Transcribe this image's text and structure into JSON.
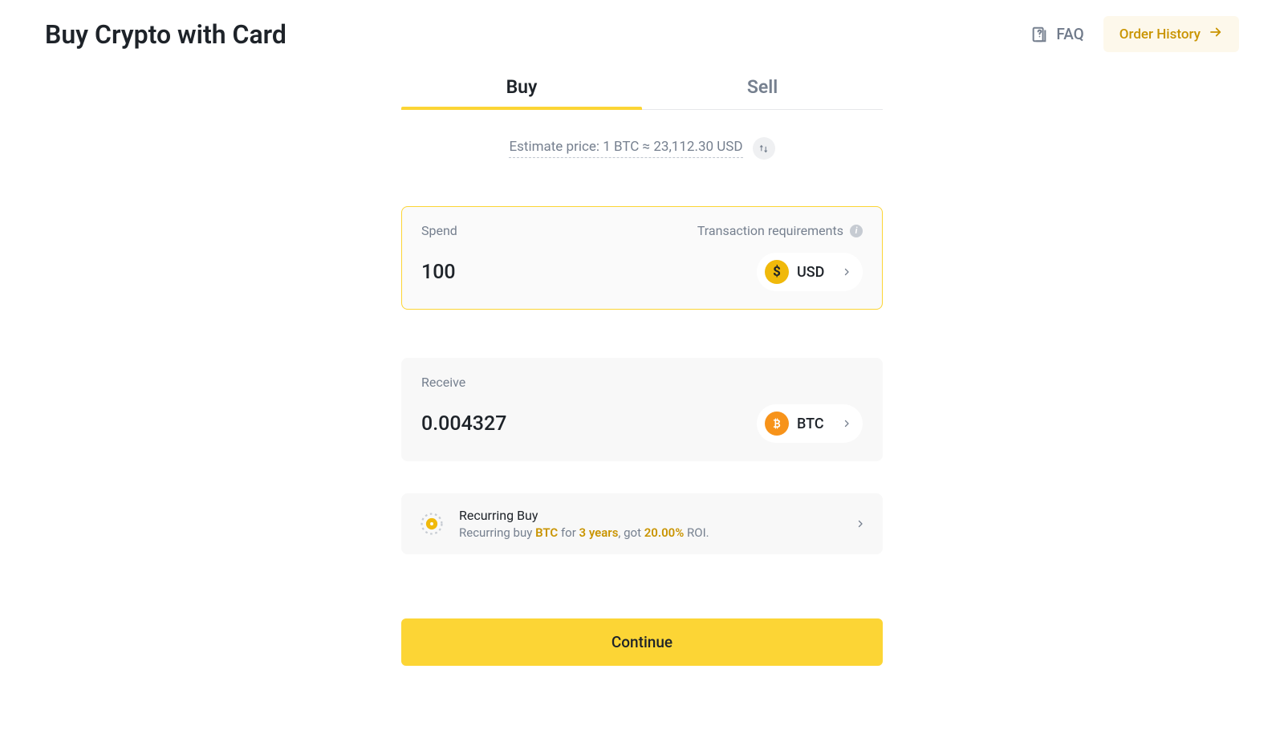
{
  "header": {
    "title": "Buy Crypto with Card",
    "faq_label": "FAQ",
    "order_history_label": "Order History"
  },
  "tabs": {
    "buy": "Buy",
    "sell": "Sell"
  },
  "estimate": {
    "text": "Estimate price: 1 BTC ≈ 23,112.30 USD"
  },
  "spend": {
    "label": "Spend",
    "tx_req_label": "Transaction requirements",
    "amount": "100",
    "currency": "USD",
    "currency_symbol": "$"
  },
  "receive": {
    "label": "Receive",
    "amount": "0.004327",
    "currency": "BTC"
  },
  "recurring": {
    "title": "Recurring Buy",
    "sub_prefix": "Recurring buy ",
    "sub_asset": "BTC",
    "sub_for": " for ",
    "sub_period": "3 years",
    "sub_got": ", got ",
    "sub_roi": "20.00%",
    "sub_suffix": " ROI."
  },
  "actions": {
    "continue": "Continue"
  }
}
